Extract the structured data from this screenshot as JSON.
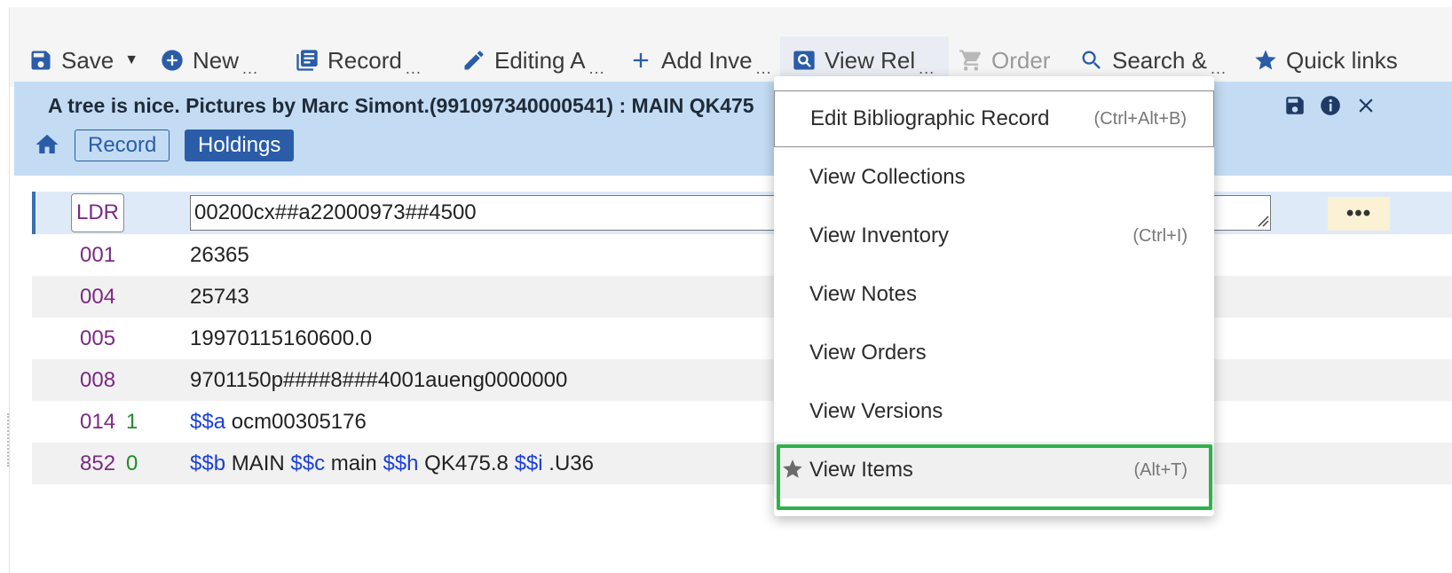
{
  "toolbar": {
    "save": "Save",
    "new": "New",
    "record": "Record",
    "editing": "Editing A",
    "add_inventory": "Add Inve",
    "view_related": "View Rel",
    "order": "Order",
    "search": "Search &",
    "quick_links": "Quick links",
    "more_glyph": "..."
  },
  "record_header": {
    "title": "A tree is nice. Pictures by Marc Simont.(991097340000541) : MAIN QK475",
    "breadcrumb_record": "Record",
    "breadcrumb_holdings": "Holdings"
  },
  "marc": {
    "ldr": {
      "tag": "LDR",
      "value": "00200cx##a22000973##4500",
      "more": "•••"
    },
    "rows": [
      {
        "tag": "001",
        "ind": "",
        "value": "26365"
      },
      {
        "tag": "004",
        "ind": "",
        "value": "25743"
      },
      {
        "tag": "005",
        "ind": "",
        "value": "19970115160600.0"
      },
      {
        "tag": "008",
        "ind": "",
        "value": "9701150p####8###4001aueng0000000"
      },
      {
        "tag": "014",
        "ind": "1",
        "sf1": "$$a",
        "v1": " ocm00305176"
      },
      {
        "tag": "852",
        "ind": "0",
        "sf1": "$$b",
        "v1": " MAIN ",
        "sf2": "$$c",
        "v2": " main ",
        "sf3": "$$h",
        "v3": " QK475.8 ",
        "sf4": "$$i",
        "v4": " .U36"
      }
    ]
  },
  "dropdown": {
    "items": [
      {
        "label": "Edit Bibliographic Record",
        "shortcut": "(Ctrl+Alt+B)"
      },
      {
        "label": "View Collections",
        "shortcut": ""
      },
      {
        "label": "View Inventory",
        "shortcut": "(Ctrl+I)"
      },
      {
        "label": "View Notes",
        "shortcut": ""
      },
      {
        "label": "View Orders",
        "shortcut": ""
      },
      {
        "label": "View Versions",
        "shortcut": ""
      },
      {
        "label": "View Items",
        "shortcut": "(Alt+T)"
      }
    ]
  },
  "colors": {
    "accent": "#2a5ca8",
    "header_bg": "#c3dcf3",
    "highlight": "#2db24a",
    "tag_color": "#7a2a82",
    "subfield_color": "#1b3fd8"
  }
}
